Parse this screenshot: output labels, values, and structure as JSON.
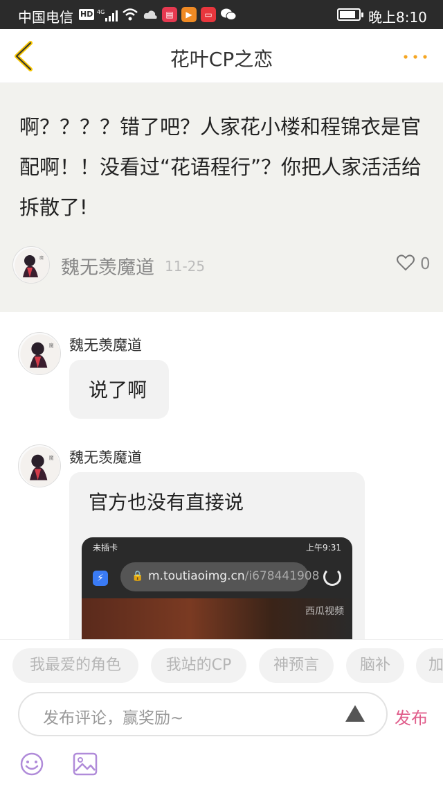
{
  "status_bar": {
    "carrier": "中国电信",
    "hd": "HD",
    "network": "4G",
    "time": "晚上8:10",
    "battery_level": 0.85
  },
  "header": {
    "title": "花叶CP之恋",
    "back_icon": "chevron-left-icon",
    "more_icon": "more-dots-icon",
    "accent_color": "#f5a623"
  },
  "original_comment": {
    "text": "啊？？？？错了吧？人家花小楼和程锦衣是官配啊！！没看过“花语程行”？你把人家活活给拆散了!",
    "user": "魏无羡魔道",
    "date": "11-25",
    "likes": "0"
  },
  "replies": [
    {
      "user": "魏无羡魔道",
      "text": "说了啊"
    },
    {
      "user": "魏无羡魔道",
      "text": "官方也没有直接说"
    }
  ],
  "embedded_screenshot": {
    "status_left": "未插卡",
    "status_time": "上午9:31",
    "url_main": "m.toutiaoimg.cn",
    "url_rest": "/i678441908",
    "watermark": "西瓜视频"
  },
  "tags": [
    "我最爱的角色",
    "我站的CP",
    "神预言",
    "脑补",
    "加"
  ],
  "composer": {
    "placeholder": "发布评论，赢奖励~",
    "publish_label": "发布",
    "publish_color": "#e05d8b"
  }
}
